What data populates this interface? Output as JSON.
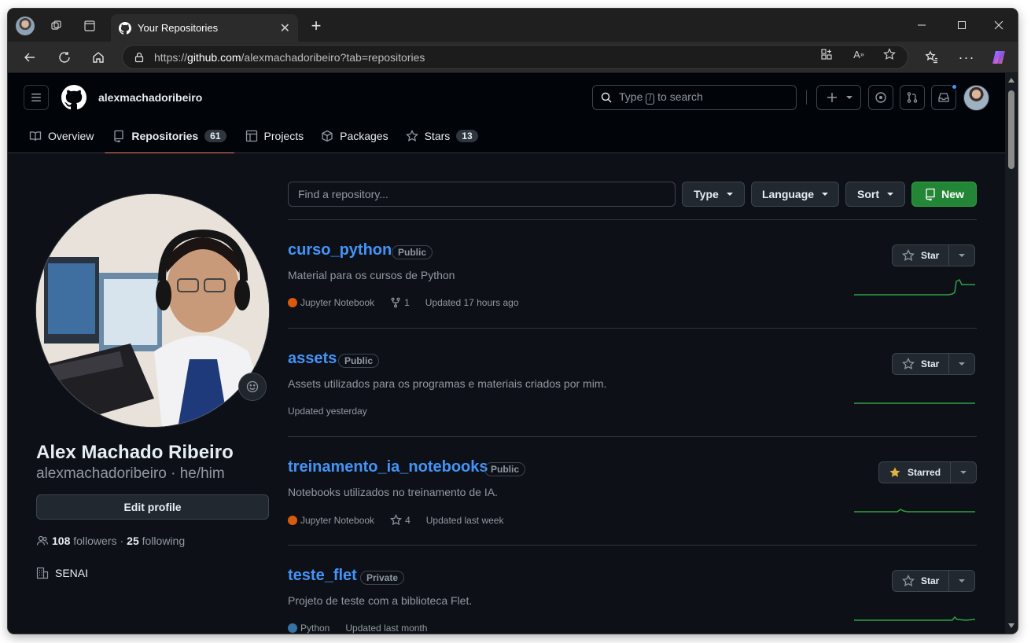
{
  "browser": {
    "tab_title": "Your Repositories",
    "url_prefix": "https://",
    "url_host": "github.com",
    "url_path": "/alexmachadoribeiro?tab=repositories",
    "window_controls": [
      "minimize-icon",
      "maximize-icon",
      "close-icon"
    ]
  },
  "header": {
    "username": "alexmachadoribeiro",
    "search_pre": "Type",
    "search_key": "/",
    "search_post": "to search"
  },
  "nav": {
    "overview": "Overview",
    "repositories": "Repositories",
    "repositories_count": "61",
    "projects": "Projects",
    "packages": "Packages",
    "stars": "Stars",
    "stars_count": "13"
  },
  "profile": {
    "name": "Alex Machado Ribeiro",
    "login": "alexmachadoribeiro · he/him",
    "edit_label": "Edit profile",
    "followers": "108",
    "followers_label": "followers",
    "separator": "·",
    "following": "25",
    "following_label": "following",
    "org": "SENAI"
  },
  "filters": {
    "find_placeholder": "Find a repository...",
    "type": "Type",
    "language": "Language",
    "sort": "Sort",
    "new": "New"
  },
  "repos": [
    {
      "name": "curso_python",
      "visibility": "Public",
      "description": "Material para os cursos de Python",
      "language": "Jupyter Notebook",
      "language_color": "#DA5B0B",
      "forks": "1",
      "updated": "Updated 17 hours ago",
      "star_label": "Star"
    },
    {
      "name": "assets",
      "visibility": "Public",
      "description": "Assets utilizados para os programas e materiais criados por mim.",
      "updated": "Updated yesterday",
      "star_label": "Star"
    },
    {
      "name": "treinamento_ia_notebooks",
      "visibility": "Public",
      "description": "Notebooks utilizados no treinamento de IA.",
      "language": "Jupyter Notebook",
      "language_color": "#DA5B0B",
      "stars": "4",
      "updated": "Updated last week",
      "star_label": "Starred"
    },
    {
      "name": "teste_flet",
      "visibility": "Private",
      "description": "Projeto de teste com a biblioteca Flet.",
      "language": "Python",
      "language_color": "#3572A5",
      "updated": "Updated last month",
      "star_label": "Star"
    }
  ],
  "colors": {
    "link": "#4493f8",
    "green": "#238636",
    "sparkline": "#2ea043",
    "starred": "#e3b341"
  }
}
